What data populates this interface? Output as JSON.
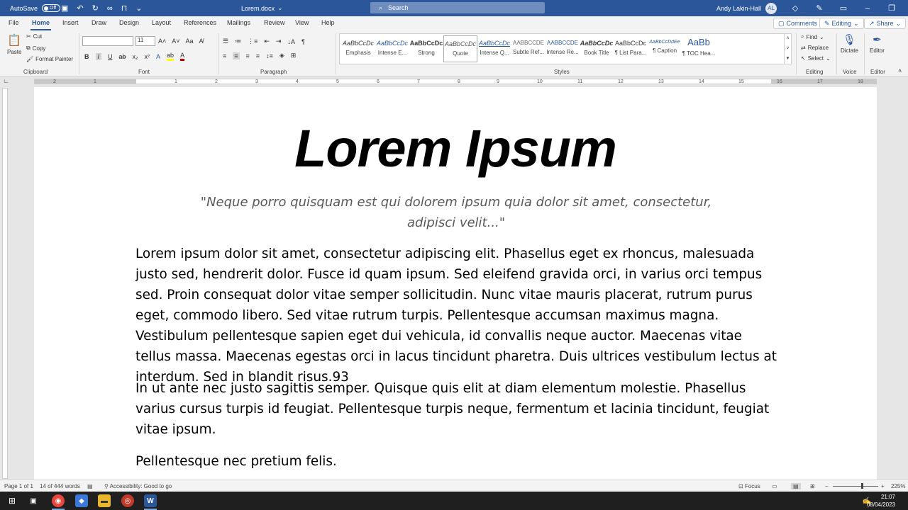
{
  "titlebar": {
    "autosave_label": "AutoSave",
    "autosave_state": "Off",
    "doc_title": "Lorem.docx",
    "search_placeholder": "Search",
    "user_name": "Andy Lakin-Hall",
    "user_initials": "AL"
  },
  "menu": {
    "tabs": [
      "File",
      "Home",
      "Insert",
      "Draw",
      "Design",
      "Layout",
      "References",
      "Mailings",
      "Review",
      "View",
      "Help"
    ],
    "active_tab": "Home",
    "comments_label": "Comments",
    "editing_label": "Editing",
    "share_label": "Share"
  },
  "ribbon": {
    "clipboard": {
      "paste": "Paste",
      "cut": "Cut",
      "copy": "Copy",
      "format_painter": "Format Painter",
      "label": "Clipboard"
    },
    "font": {
      "font_name": "",
      "font_size": "11",
      "label": "Font"
    },
    "paragraph": {
      "label": "Paragraph"
    },
    "styles": {
      "label": "Styles",
      "items": [
        {
          "preview": "AaBbCcDc",
          "name": "Emphasis"
        },
        {
          "preview": "AaBbCcDc",
          "name": "Intense E..."
        },
        {
          "preview": "AaBbCcDc",
          "name": "Strong"
        },
        {
          "preview": "AaBbCcDc",
          "name": "Quote"
        },
        {
          "preview": "AaBbCcDc",
          "name": "Intense Q..."
        },
        {
          "preview": "AABBCCDE",
          "name": "Subtle Ref..."
        },
        {
          "preview": "AABBCCDE",
          "name": "Intense Re..."
        },
        {
          "preview": "AaBbCcDc",
          "name": "Book Title"
        },
        {
          "preview": "AaBbCcDc",
          "name": "¶ List Para..."
        },
        {
          "preview": "AaBbCcDdEe",
          "name": "¶ Caption"
        },
        {
          "preview": "AaBb",
          "name": "¶ TOC Hea..."
        }
      ],
      "selected": "Quote"
    },
    "editing": {
      "find": "Find",
      "replace": "Replace",
      "select": "Select",
      "label": "Editing"
    },
    "voice": {
      "dictate": "Dictate",
      "label": "Voice"
    },
    "editor": {
      "editor": "Editor",
      "label": "Editor"
    }
  },
  "ruler": {
    "numbers": [
      "2",
      "1",
      "1",
      "2",
      "3",
      "4",
      "5",
      "6",
      "7",
      "8",
      "9",
      "10",
      "11",
      "12",
      "13",
      "14",
      "15",
      "16",
      "17",
      "18"
    ]
  },
  "document": {
    "heading": "Lorem Ipsum",
    "quote": "\"Neque porro quisquam est qui dolorem ipsum quia dolor sit amet, consectetur, adipisci velit...\"",
    "paragraphs": [
      "Lorem ipsum dolor sit amet, consectetur adipiscing elit. Phasellus eget ex rhoncus, malesuada justo sed, hendrerit dolor. Fusce id quam ipsum. Sed eleifend gravida orci, in varius orci tempus sed. Proin consequat dolor vitae semper sollicitudin. Nunc vitae mauris placerat, rutrum purus eget, commodo libero. Sed vitae rutrum turpis. Pellentesque accumsan maximus magna. Vestibulum pellentesque sapien eget dui vehicula, id convallis neque auctor. Maecenas vitae tellus massa. Maecenas egestas orci in lacus tincidunt pharetra. Duis ultrices vestibulum lectus at interdum. Sed in blandit risus.93",
      "In ut ante nec justo sagittis semper. Quisque quis elit at diam elementum molestie. Phasellus varius cursus turpis id feugiat. Pellentesque turpis neque, fermentum et lacinia tincidunt, feugiat vitae ipsum.",
      "Pellentesque nec pretium felis."
    ]
  },
  "statusbar": {
    "page": "Page 1 of 1",
    "words": "14 of 444 words",
    "accessibility": "Accessibility: Good to go",
    "focus": "Focus",
    "zoom": "225%"
  },
  "taskbar": {
    "time": "21:07",
    "date": "08/04/2023"
  },
  "colors": {
    "word_blue": "#2b579a",
    "ribbon_bg": "#f3f3f3",
    "taskbar_bg": "#1f1f1f",
    "quote_gray": "#595959"
  }
}
